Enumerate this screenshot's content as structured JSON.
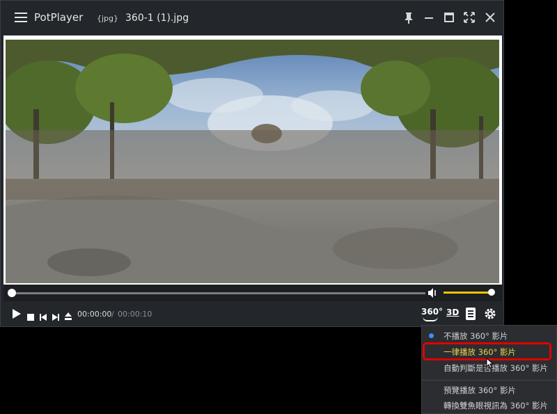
{
  "window": {
    "app_name": "PotPlayer",
    "file_ext": "{jpg}",
    "file_name": "360-1 (1).jpg"
  },
  "playback": {
    "current_time": "00:00:00",
    "separator": "/",
    "total_time": "00:00:10",
    "progress_fraction": 0.0,
    "volume_fraction": 1.0
  },
  "controls": {
    "btn_360": "360°",
    "btn_3d": "3D"
  },
  "menu": {
    "items": [
      {
        "label": "不播放 360° 影片",
        "selected": true
      },
      {
        "label": "一律播放 360° 影片",
        "hovered": true
      },
      {
        "label": "自動判斷是否播放 360° 影片"
      },
      {
        "label": "預覽播放 360° 影片"
      },
      {
        "label": "轉換雙魚眼視訊為 360° 影片"
      }
    ]
  },
  "colors": {
    "accent_volume": "#f5c400",
    "menu_highlight_text": "#f2d34a",
    "annotation_box": "#e00000",
    "radio_dot": "#3f8bff"
  }
}
